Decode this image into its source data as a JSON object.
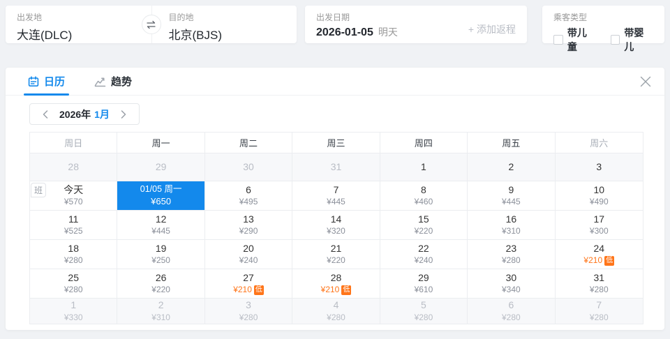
{
  "colors": {
    "accent": "#1389ec",
    "orange": "#ff7519",
    "page_bg": "#f0f2f5",
    "border": "#ebedf0",
    "dim_row_bg": "#f7f8fa",
    "text_dark": "#333333",
    "text_gray": "#999999",
    "text_muted": "#b9bdc5"
  },
  "search": {
    "from": {
      "label": "出发地",
      "value": "大连(DLC)"
    },
    "to": {
      "label": "目的地",
      "value": "北京(BJS)"
    },
    "date": {
      "label": "出发日期",
      "value": "2026-01-05",
      "hint": "明天"
    },
    "add_return_label": "+ 添加返程",
    "passenger": {
      "label": "乘客类型",
      "child_option": "带儿童",
      "infant_option": "带婴儿"
    }
  },
  "panel": {
    "tabs": {
      "calendar": "日历",
      "trend": "趋势"
    },
    "month_nav": {
      "year": "2026年",
      "month": "1月"
    },
    "flight_tag": "班",
    "calendar": {
      "weekdays": [
        "周日",
        "周一",
        "周二",
        "周三",
        "周四",
        "周五",
        "周六"
      ],
      "low_badge": "低",
      "rows": [
        {
          "dim": true,
          "cells": [
            {
              "day": "28",
              "muted": true
            },
            {
              "day": "29",
              "muted": true
            },
            {
              "day": "30",
              "muted": true
            },
            {
              "day": "31",
              "muted": true
            },
            {
              "day": "1"
            },
            {
              "day": "2"
            },
            {
              "day": "3"
            }
          ]
        },
        {
          "cells": [
            {
              "day": "今天",
              "price": "¥570"
            },
            {
              "day": "01/05 周一",
              "price": "¥650",
              "selected": true
            },
            {
              "day": "6",
              "price": "¥495"
            },
            {
              "day": "7",
              "price": "¥445"
            },
            {
              "day": "8",
              "price": "¥460"
            },
            {
              "day": "9",
              "price": "¥445"
            },
            {
              "day": "10",
              "price": "¥490"
            }
          ]
        },
        {
          "cells": [
            {
              "day": "11",
              "price": "¥525"
            },
            {
              "day": "12",
              "price": "¥445"
            },
            {
              "day": "13",
              "price": "¥290"
            },
            {
              "day": "14",
              "price": "¥320"
            },
            {
              "day": "15",
              "price": "¥220"
            },
            {
              "day": "16",
              "price": "¥310"
            },
            {
              "day": "17",
              "price": "¥300"
            }
          ]
        },
        {
          "cells": [
            {
              "day": "18",
              "price": "¥280"
            },
            {
              "day": "19",
              "price": "¥250"
            },
            {
              "day": "20",
              "price": "¥240"
            },
            {
              "day": "21",
              "price": "¥220"
            },
            {
              "day": "22",
              "price": "¥240"
            },
            {
              "day": "23",
              "price": "¥280"
            },
            {
              "day": "24",
              "price": "¥210",
              "low": true
            }
          ]
        },
        {
          "cells": [
            {
              "day": "25",
              "price": "¥280"
            },
            {
              "day": "26",
              "price": "¥220"
            },
            {
              "day": "27",
              "price": "¥210",
              "low": true
            },
            {
              "day": "28",
              "price": "¥210",
              "low": true
            },
            {
              "day": "29",
              "price": "¥610"
            },
            {
              "day": "30",
              "price": "¥340"
            },
            {
              "day": "31",
              "price": "¥280"
            }
          ]
        },
        {
          "dim": true,
          "cells": [
            {
              "day": "1",
              "price": "¥330",
              "muted": true
            },
            {
              "day": "2",
              "price": "¥310",
              "muted": true
            },
            {
              "day": "3",
              "price": "¥280",
              "muted": true
            },
            {
              "day": "4",
              "price": "¥280",
              "muted": true
            },
            {
              "day": "5",
              "price": "¥280",
              "muted": true
            },
            {
              "day": "6",
              "price": "¥280",
              "muted": true
            },
            {
              "day": "7",
              "price": "¥280",
              "muted": true
            }
          ]
        }
      ]
    }
  }
}
